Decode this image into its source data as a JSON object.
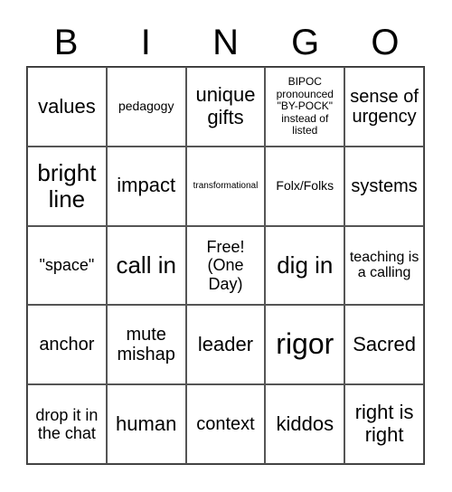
{
  "header": [
    "B",
    "I",
    "N",
    "G",
    "O"
  ],
  "cells": [
    "values",
    "pedagogy",
    "unique gifts",
    "BIPOC pronounced \"BY-POCK\" instead of listed",
    "sense of urgency",
    "bright line",
    "impact",
    "transformational",
    "Folx/Folks",
    "systems",
    "\"space\"",
    "call in",
    "Free! (One Day)",
    "dig in",
    "teaching is a calling",
    "anchor",
    "mute mishap",
    "leader",
    "rigor",
    "Sacred",
    "drop it in the chat",
    "human",
    "context",
    "kiddos",
    "right is right"
  ]
}
